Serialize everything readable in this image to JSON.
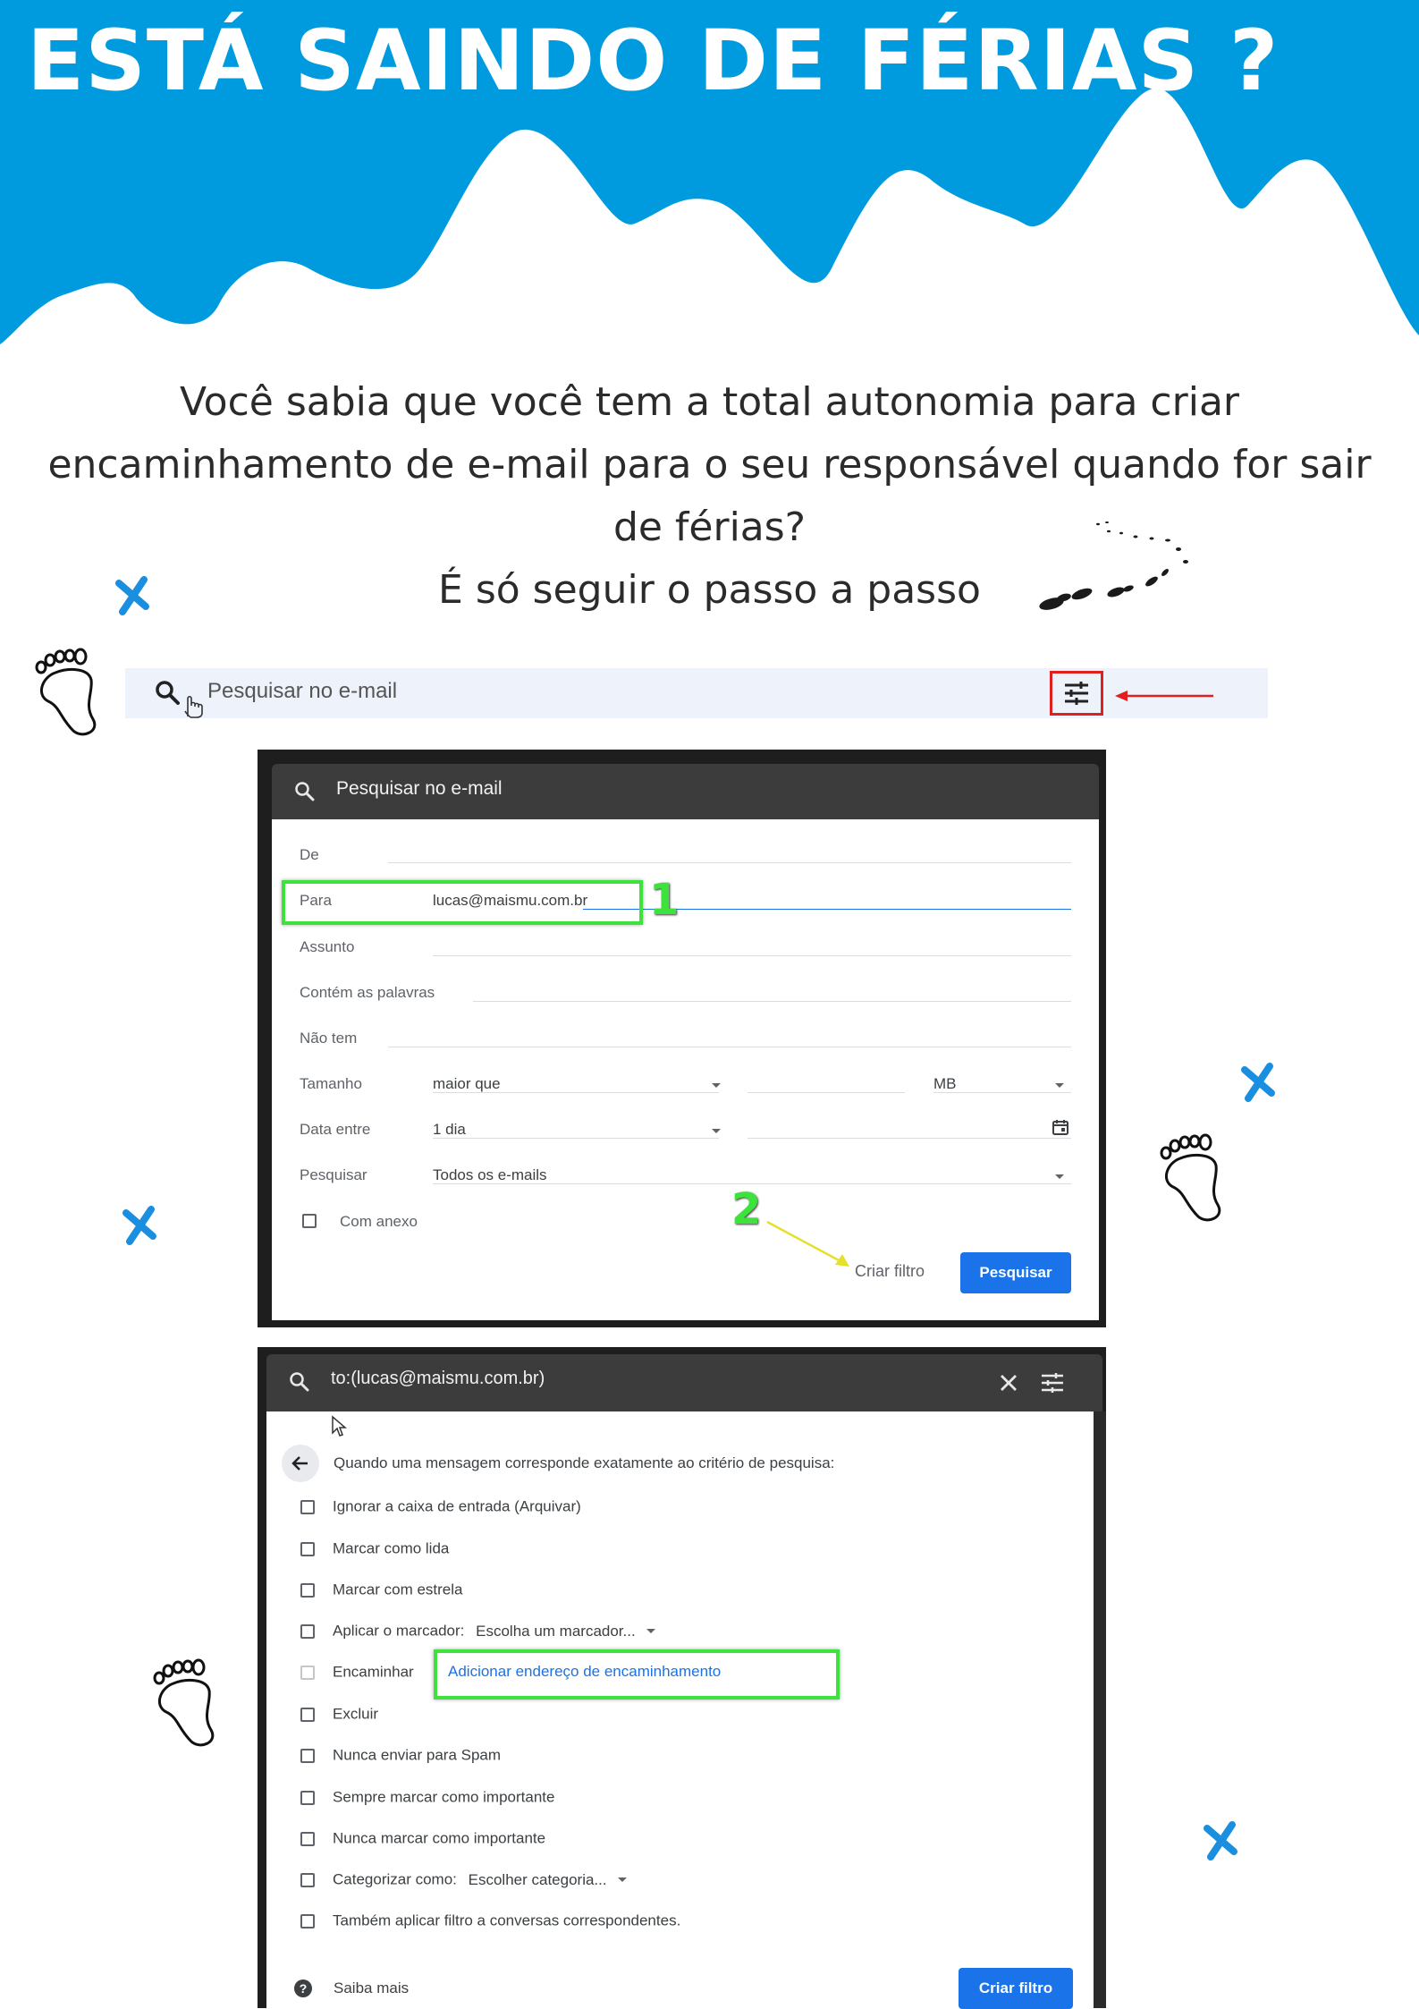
{
  "colors": {
    "accent": "#009ade",
    "link": "#1a73e8",
    "highlight": "#3de23d",
    "alert": "#e02020"
  },
  "hero": {
    "title": "ESTÁ SAINDO DE FÉRIAS ?"
  },
  "intro": {
    "line1": "Você sabia que você tem a total autonomia para criar",
    "line2": "encaminhamento de e-mail para o seu responsável quando for sair",
    "line3": "de férias?",
    "line4": "É só seguir o passo a passo"
  },
  "search_bar": {
    "placeholder": "Pesquisar no e-mail",
    "icons": [
      "search-icon",
      "hand-cursor-icon",
      "tune-icon"
    ]
  },
  "filter_form": {
    "title": "Pesquisar no e-mail",
    "fields": {
      "de": "De",
      "para": "Para",
      "para_value": "lucas@maismu.com.br",
      "assunto": "Assunto",
      "contem": "Contém as palavras",
      "nao_tem": "Não tem",
      "tamanho": "Tamanho",
      "tamanho_value": "maior que",
      "tamanho_unit": "MB",
      "data": "Data entre",
      "data_value": "1 dia",
      "pesquisar": "Pesquisar",
      "pesquisar_value": "Todos os e-mails",
      "anexo": "Com anexo"
    },
    "step1": "1",
    "step2": "2",
    "criar_filtro": "Criar filtro",
    "pesquisar_button": "Pesquisar"
  },
  "filter_actions": {
    "query": "to:(lucas@maismu.com.br)",
    "criteria": "Quando uma mensagem corresponde exatamente ao critério de pesquisa:",
    "items": [
      "Ignorar a caixa de entrada (Arquivar)",
      "Marcar como lida",
      "Marcar com estrela",
      "Aplicar o marcador:",
      "Encaminhar",
      "Excluir",
      "Nunca enviar para Spam",
      "Sempre marcar como importante",
      "Nunca marcar como importante",
      "Categorizar como:",
      "Também aplicar filtro a conversas correspondentes."
    ],
    "label_select": "Escolha um marcador...",
    "category_select": "Escolher categoria...",
    "forward_link": "Adicionar endereço de encaminhamento",
    "saiba_mais": "Saiba mais",
    "criar_filtro_button": "Criar filtro"
  }
}
